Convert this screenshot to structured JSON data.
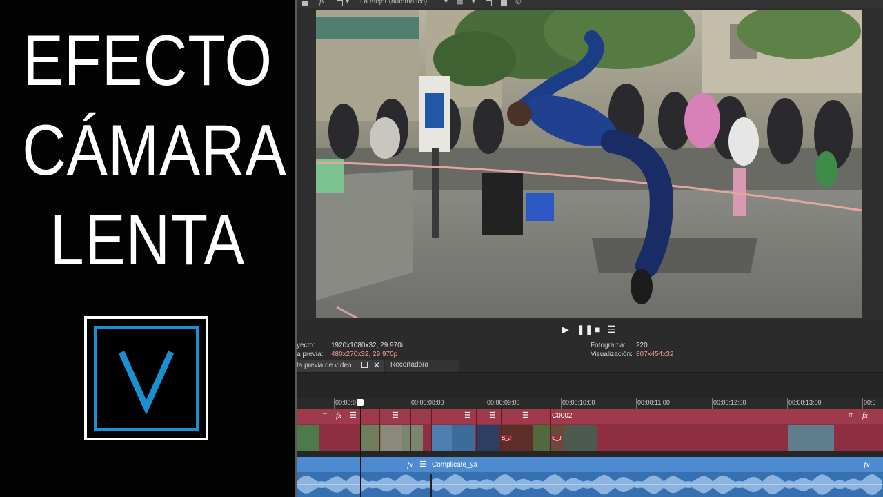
{
  "title_panel": {
    "line1": "EFECTO",
    "line2": "CÁMARA",
    "line3": "LENTA",
    "logo": {
      "letter_icon": "vegas-v-logo",
      "color": "#1a8fd1"
    }
  },
  "preview_toolbar": {
    "quality_label": "La mejor (automático)"
  },
  "preview": {
    "image": "street-performer-limbo-photo"
  },
  "transport": {
    "play_icon": "play-icon",
    "pause_icon": "pause-icon",
    "stop_icon": "stop-icon",
    "menu_icon": "menu-icon"
  },
  "info": {
    "project_label": "yecto:",
    "project_value": "1920x1080x32, 29.970i",
    "preview_label": "a previa:",
    "preview_value": "480x270x32, 29.970p",
    "frame_label": "Fotograma:",
    "frame_value": "220",
    "display_label": "Visualización:",
    "display_value": "807x454x32"
  },
  "tabs": {
    "preview_tab": "ta previa de vídeo",
    "trimmer_tab": "Recortadora"
  },
  "ruler": {
    "labels": [
      "00:00:0",
      "00:00:08:00",
      "00:00:09:00",
      "00:00:10:00",
      "00:00:11:00",
      "00:00:12:00",
      "00:00:13:00",
      "00:0"
    ]
  },
  "video_track": {
    "event_label": "C0002",
    "s_label": "S_J",
    "color": "#9e3a4c"
  },
  "audio_track": {
    "event_label": "Complicate_ya",
    "color": "#4d8ad0"
  }
}
